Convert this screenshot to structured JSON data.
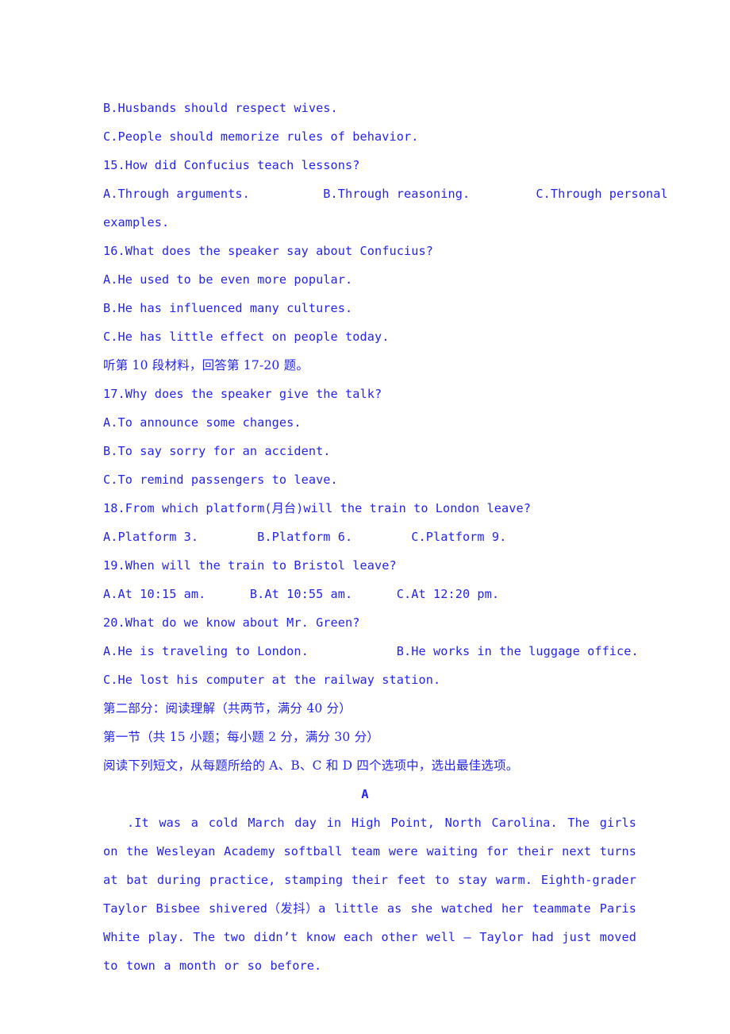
{
  "document": {
    "text_color": "#2424e8",
    "background_color": "#ffffff",
    "lines": {
      "opt_14_b": "B.Husbands should respect wives.",
      "opt_14_c": "C.People should memorize rules of behavior.",
      "q15": "15.How did Confucius teach lessons?",
      "q15_options": "A.Through arguments.          B.Through reasoning.         C.Through personal",
      "q15_options_cont": "examples.",
      "q16": "16.What does the speaker say about Confucius?",
      "q16_a": "A.He used to be even more popular.",
      "q16_b": "B.He has influenced many cultures.",
      "q16_c": "C.He has little effect on people today.",
      "listen_10": "听第 10 段材料，回答第 17-20 题。",
      "q17": "17.Why does the speaker give the talk?",
      "q17_a": "A.To announce some changes.",
      "q17_b": "B.To say sorry for an accident.",
      "q17_c": "C.To remind passengers to leave.",
      "q18": "18.From which platform(月台)will the train to London leave?",
      "q18_options": "A.Platform 3.        B.Platform 6.        C.Platform 9.",
      "q19": "19.When will the train to Bristol leave?",
      "q19_options": "A.At 10:15 am.      B.At 10:55 am.      C.At 12:20 pm.",
      "q20": "20.What do we know about Mr. Green?",
      "q20_options_ab": "A.He is traveling to London.            B.He works in the luggage office.",
      "q20_c": "C.He lost his computer at the railway station.",
      "part_two_heading": "第二部分：阅读理解（共两节，满分 40 分）",
      "section_one_heading": "第一节（共 15 小题；每小题 2 分，满分 30 分）",
      "section_one_instruction": "阅读下列短文，从每题所给的 A、B、C 和 D 四个选项中，选出最佳选项。",
      "passage_label": "A",
      "passage_paragraph": ".It was a cold March day in High Point, North Carolina. The girls on the Wesleyan Academy softball team were waiting for their next turns at bat during practice, stamping their feet to stay warm. Eighth-grader Taylor Bisbee shivered（发抖）a little as she watched her teammate Paris White play. The two didn’t know each other well — Taylor had just moved to town a month or so before."
    }
  }
}
